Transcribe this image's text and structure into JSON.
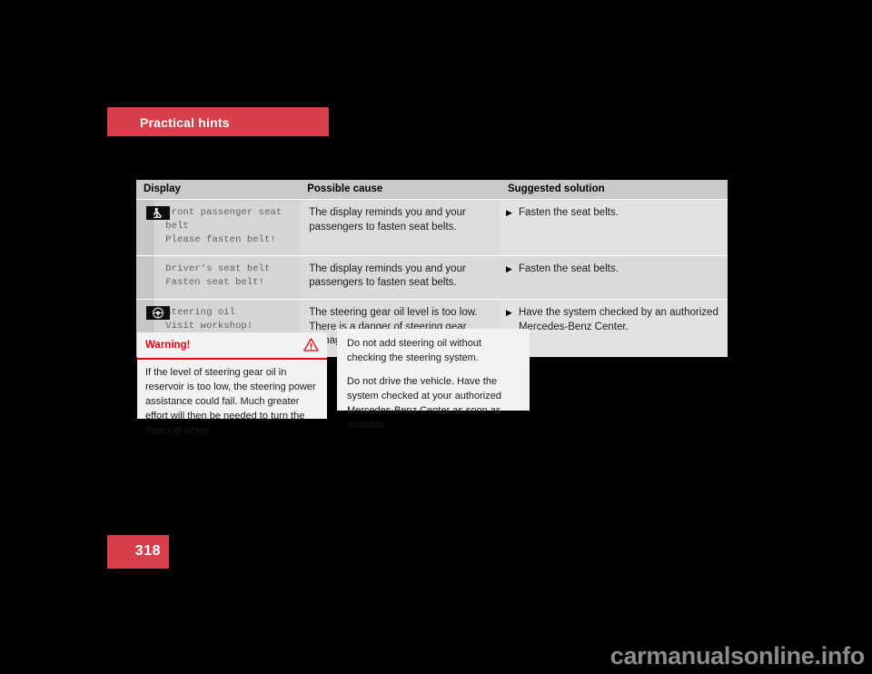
{
  "section": {
    "title": "Practical hints"
  },
  "table": {
    "headers": {
      "display": "Display",
      "cause": "Possible cause",
      "solution": "Suggested solution"
    },
    "rows": [
      {
        "icon": "seatbelt-passenger-icon",
        "display_lines": [
          "Front passenger seat",
          "belt",
          "Please fasten belt!"
        ],
        "cause": "The display reminds you and your passengers to fasten seat belts.",
        "solution_marker": "▶",
        "solution": "Fasten the seat belts."
      },
      {
        "icon": "",
        "display_lines": [
          "Driver‘s seat belt",
          "Fasten seat belt!"
        ],
        "cause": "The display reminds you and your passengers to fasten seat belts.",
        "solution_marker": "▶",
        "solution": "Fasten the seat belts."
      },
      {
        "icon": "steering-wheel-icon",
        "display_lines": [
          "Steering oil",
          "Visit workshop!"
        ],
        "cause": "The steering gear oil level is too low. There is a danger of steering gear damage.",
        "solution_marker": "▶",
        "solution": "Have the system checked by an authorized Mercedes-Benz Center."
      }
    ]
  },
  "warning": {
    "title": "Warning!",
    "icon": "warning-triangle-icon",
    "body": "If the level of steering gear oil in reservoir is too low, the steering power assistance could fail. Much greater effort will then be needed to turn the steering wheel."
  },
  "notice": {
    "paragraphs": [
      "Do not add steering oil without checking the steering system.",
      "Do not drive the vehicle. Have the system checked at your authorized Mercedes-Benz Center as soon as possible."
    ]
  },
  "page": {
    "number": "318"
  },
  "watermark": {
    "text": "carmanualsonline.info"
  },
  "colors": {
    "accent_red": "#d7404a",
    "warning_red": "#f0000f",
    "page_background": "#000000",
    "table_header": "#c9c9c9",
    "box_background": "#f2f2f2"
  }
}
